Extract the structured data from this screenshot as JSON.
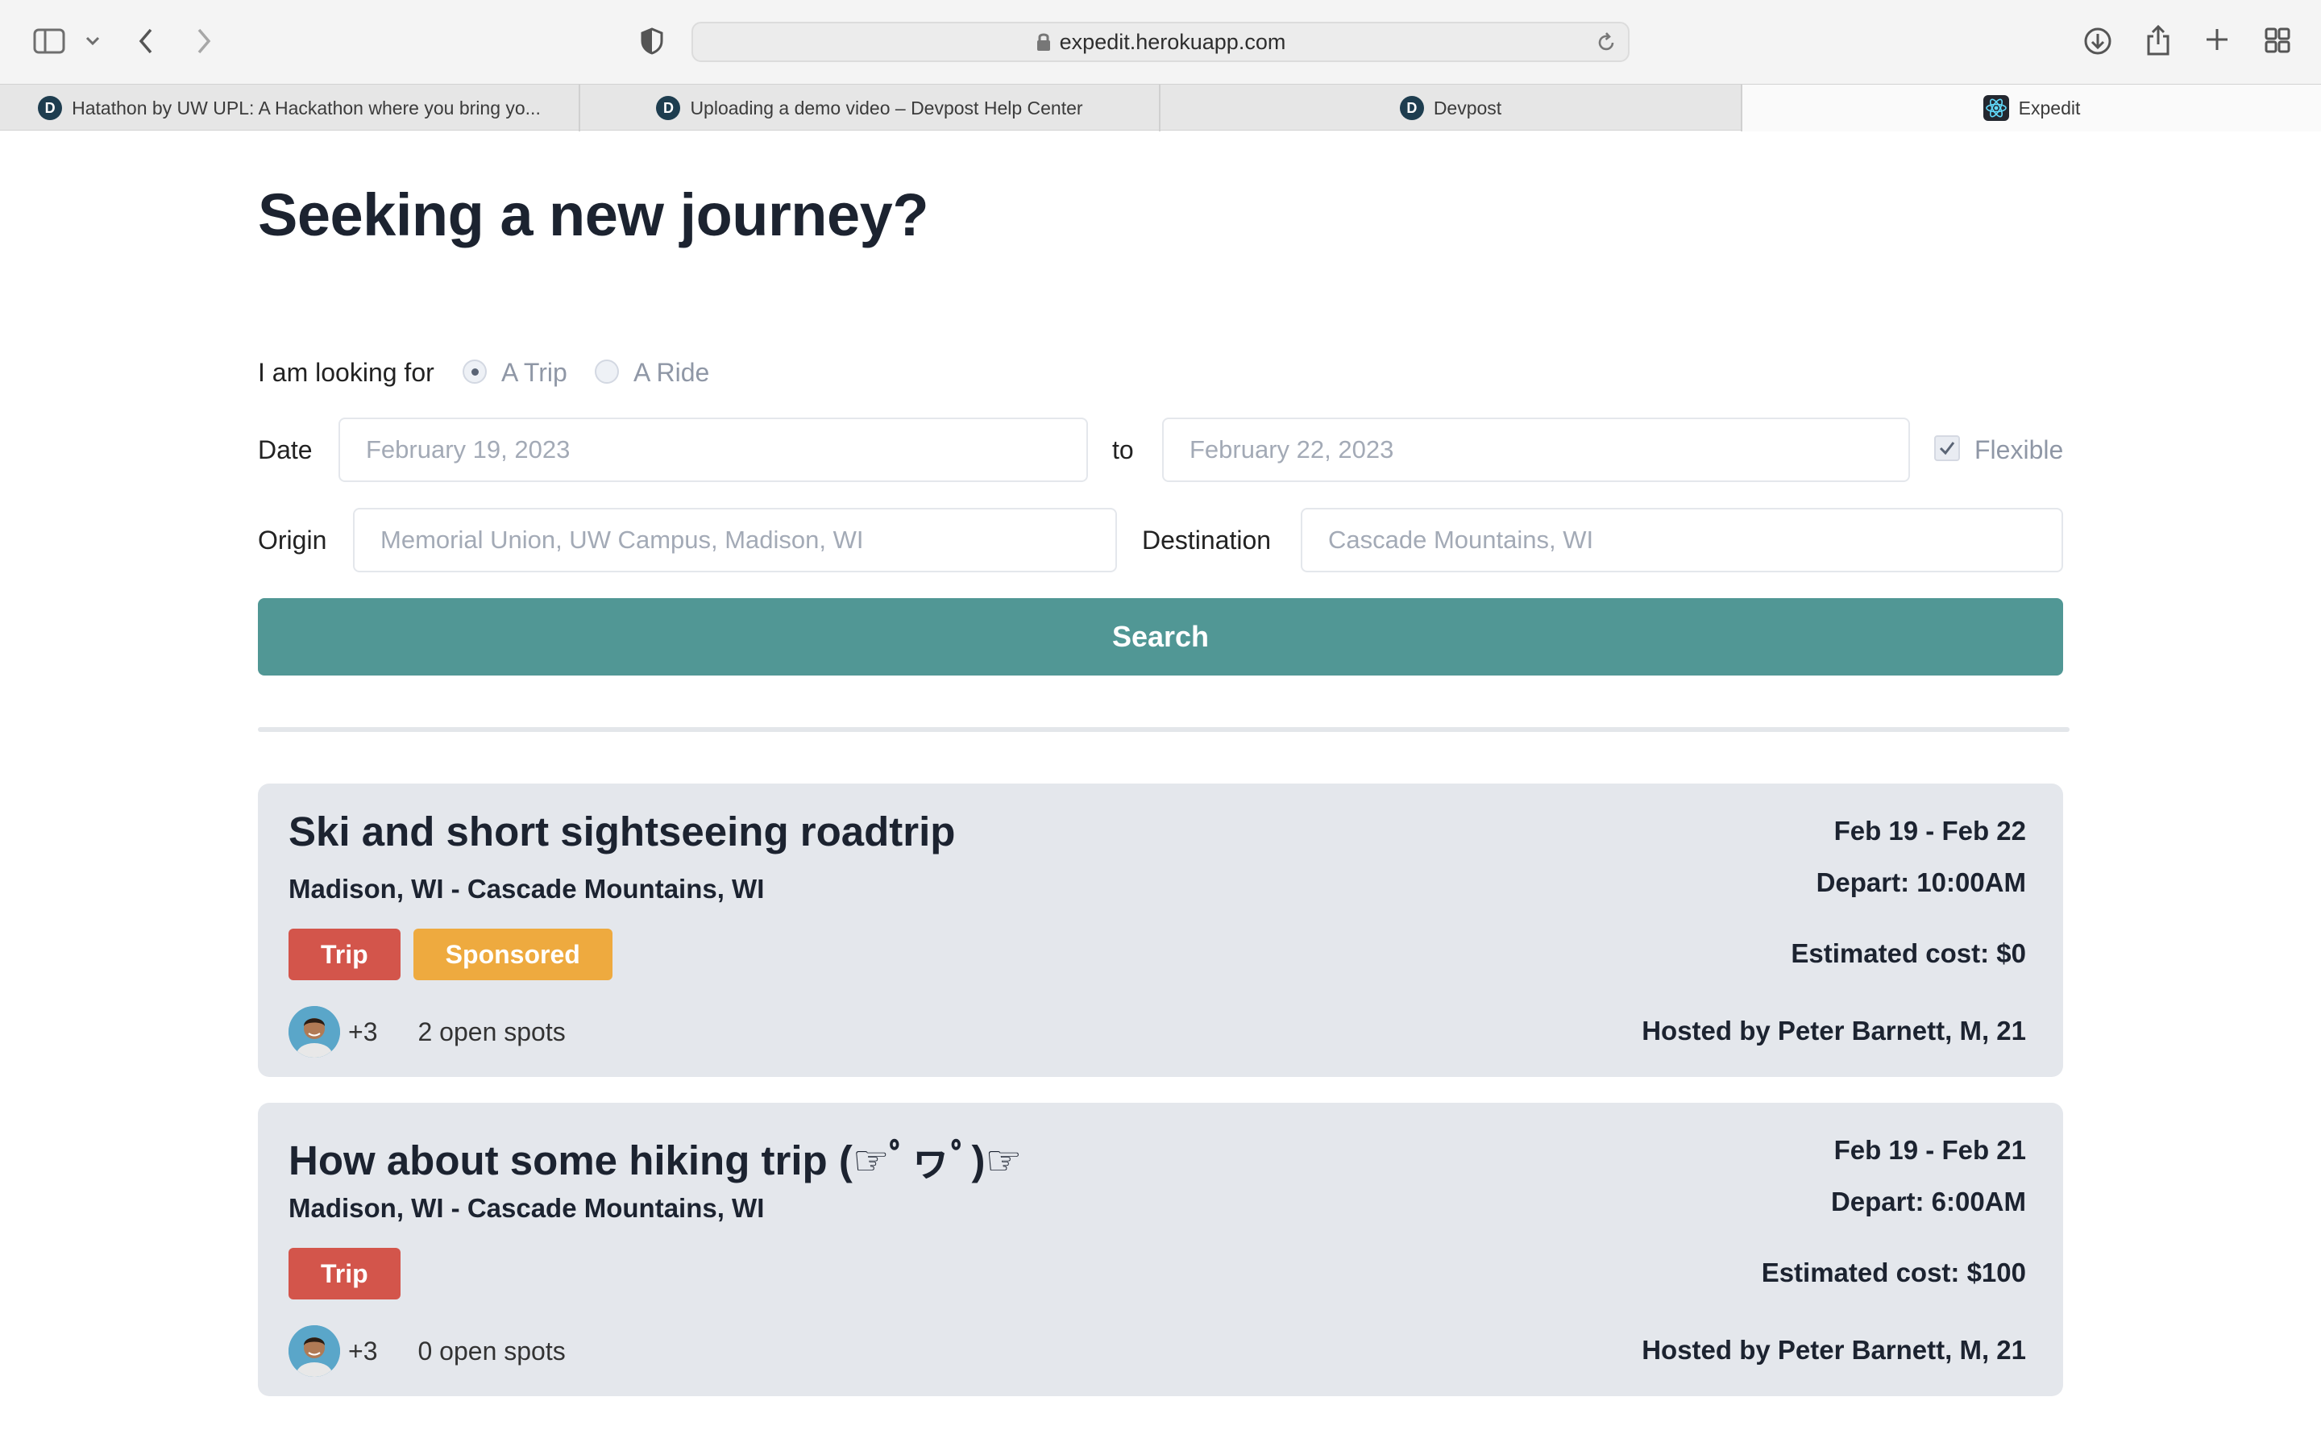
{
  "browser": {
    "url": "expedit.herokuapp.com",
    "tabs": [
      {
        "label": "Hatathon by UW UPL: A Hackathon where you bring yo...",
        "icon": "devpost-icon",
        "active": false
      },
      {
        "label": "Uploading a demo video – Devpost Help Center",
        "icon": "devpost-icon",
        "active": false
      },
      {
        "label": "Devpost",
        "icon": "devpost-icon",
        "active": false
      },
      {
        "label": "Expedit",
        "icon": "react-icon",
        "active": true
      }
    ]
  },
  "page": {
    "heading": "Seeking a new journey?",
    "looking_for_label": "I am looking for",
    "options": {
      "trip": "A Trip",
      "ride": "A Ride",
      "selected": "trip"
    },
    "date_label": "Date",
    "date_from_placeholder": "February 19, 2023",
    "to_label": "to",
    "date_to_placeholder": "February 22, 2023",
    "flexible_label": "Flexible",
    "flexible_checked": true,
    "origin_label": "Origin",
    "origin_placeholder": "Memorial Union, UW Campus, Madison, WI",
    "destination_label": "Destination",
    "destination_placeholder": "Cascade Mountains, WI",
    "search_label": "Search"
  },
  "trips": [
    {
      "title": "Ski and short sightseeing roadtrip",
      "route": "Madison, WI - Cascade Mountains, WI",
      "dates": "Feb 19 - Feb 22",
      "depart": "Depart: 10:00AM",
      "cost": "Estimated cost: $0",
      "badges": {
        "trip": "Trip",
        "sponsored": "Sponsored"
      },
      "extra_members": "+3",
      "open_spots": "2 open spots",
      "host": "Hosted by Peter Barnett, M, 21"
    },
    {
      "title": "How about some hiking trip (☞ﾟヮﾟ)☞",
      "route": "Madison, WI - Cascade Mountains, WI",
      "dates": "Feb 19 - Feb 21",
      "depart": "Depart: 6:00AM",
      "cost": "Estimated cost: $100",
      "badges": {
        "trip": "Trip"
      },
      "extra_members": "+3",
      "open_spots": "0 open spots",
      "host": "Hosted by Peter Barnett, M, 21"
    }
  ],
  "colors": {
    "primary": "#519795",
    "trip_badge": "#d3554b",
    "sponsored_badge": "#eeaa3f",
    "card_bg": "#e4e7ec"
  }
}
